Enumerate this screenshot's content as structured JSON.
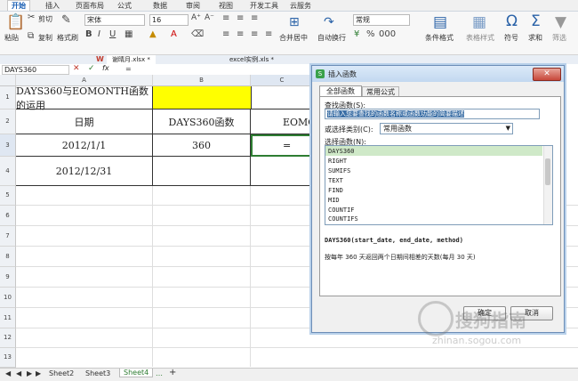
{
  "menu": [
    "开始",
    "插入",
    "页面布局",
    "公式",
    "数据",
    "审阅",
    "视图",
    "开发工具",
    "云服务"
  ],
  "ribbon": {
    "paste": "粘贴",
    "cut": "剪切",
    "copy": "复制",
    "format_painter": "格式刷",
    "font": "宋体",
    "font_size": "16",
    "merge_center": "合并居中",
    "wrap": "自动换行",
    "number_format": "常规",
    "cond_format": "条件格式",
    "table_style": "表格样式",
    "symbol": "符号",
    "sum": "求和",
    "filter": "筛选"
  },
  "tabs": [
    "谢晴月.xlsx *",
    "excel实例.xls *"
  ],
  "formula_bar": {
    "name_box": "DAYS360",
    "content": "="
  },
  "columns": [
    "A",
    "B",
    "C"
  ],
  "rows": [
    "1",
    "2",
    "3",
    "4",
    "5",
    "6",
    "7",
    "8",
    "9",
    "10",
    "11",
    "12",
    "13"
  ],
  "cells": {
    "a1": "DAYS360与EOMONTH函数的运用",
    "a2": "日期",
    "b2": "DAYS360函数",
    "c2": "EOMONTH函",
    "a3": "2012/1/1",
    "b3": "360",
    "c3": "=",
    "a4": "2012/12/31"
  },
  "sheet_tabs": [
    "Sheet2",
    "Sheet3",
    "Sheet4"
  ],
  "dialog": {
    "title": "插入函数",
    "tab_all": "全部函数",
    "tab_common": "常用公式",
    "search_label": "查找函数(S):",
    "search_value": "请输入您要查找的函数名称或函数功能的简要描述",
    "category_label": "或选择类别(C):",
    "category_value": "常用函数",
    "select_label": "选择函数(N):",
    "functions": [
      "DAYS360",
      "RIGHT",
      "SUMIFS",
      "TEXT",
      "FIND",
      "MID",
      "COUNTIF",
      "COUNTIFS"
    ],
    "signature": "DAYS360(start_date, end_date, method)",
    "description": "按每年 360 天返回两个日期间相差的天数(每月 30 天)",
    "ok": "确定",
    "cancel": "取消"
  },
  "watermark": {
    "text": "搜狗指南",
    "url": "zhinan.sogou.com"
  }
}
